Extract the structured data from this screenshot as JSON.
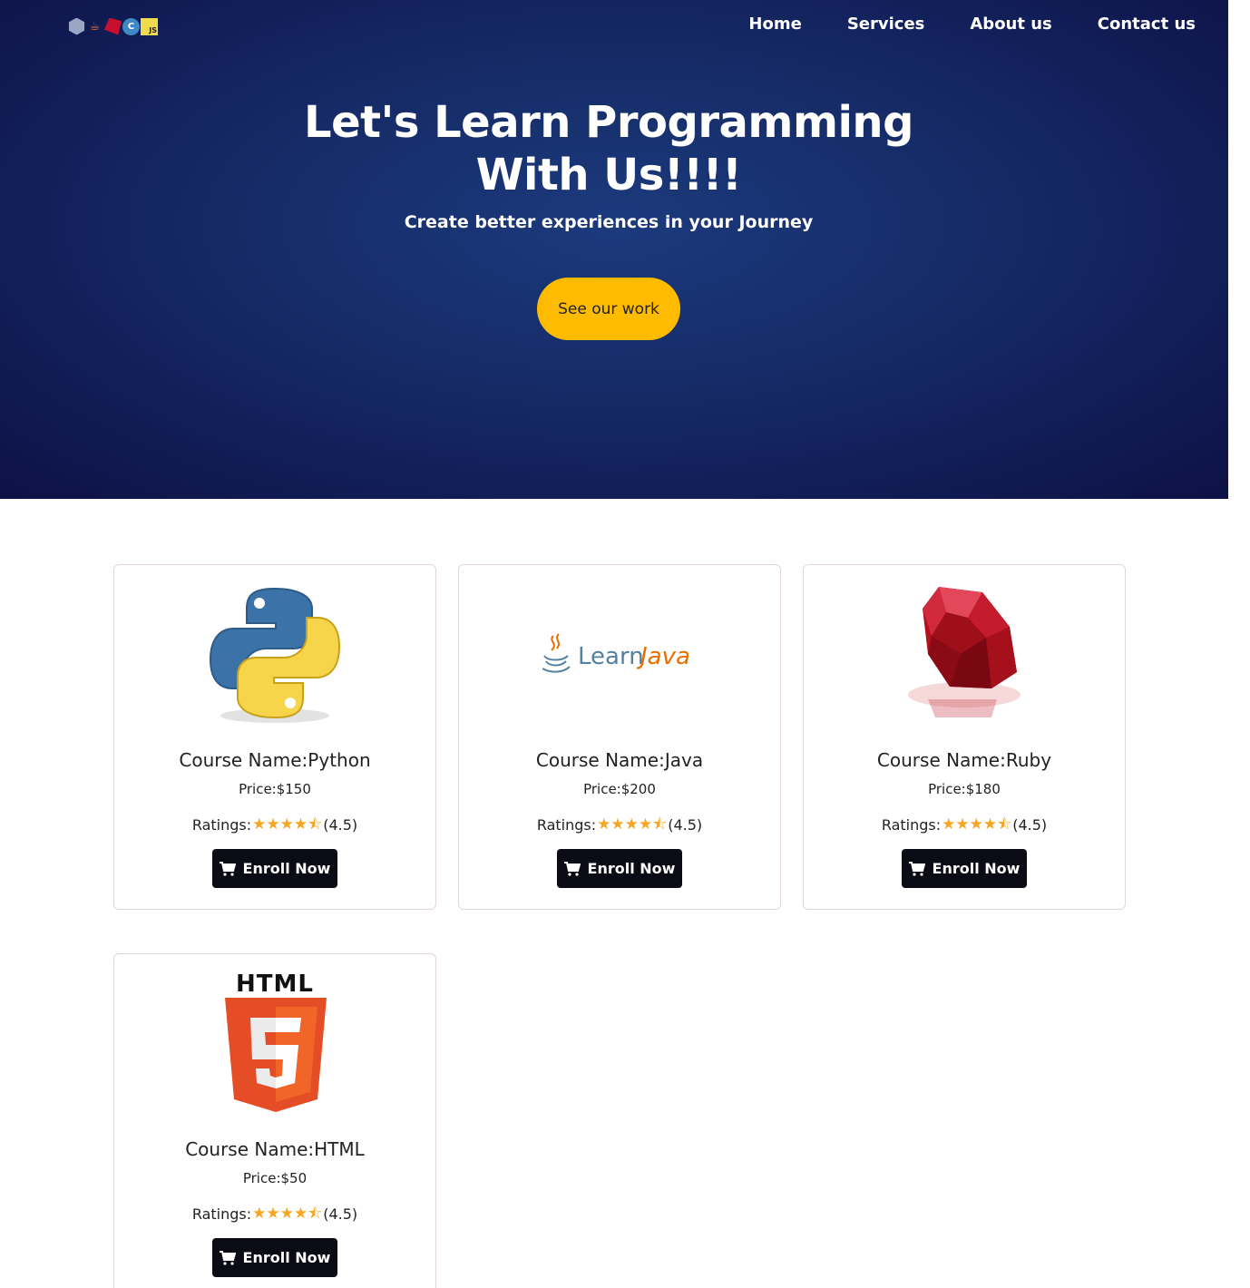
{
  "header": {
    "logo_icons": [
      "c-plus-plus-icon",
      "java-icon",
      "ruby-icon",
      "c-icon",
      "javascript-icon"
    ],
    "logo_js_text": "JS",
    "logo_c_text": "C",
    "nav": [
      {
        "label": "Home"
      },
      {
        "label": "Services"
      },
      {
        "label": "About us"
      },
      {
        "label": "Contact us"
      }
    ]
  },
  "hero": {
    "title_line1": "Let's Learn Programming",
    "title_line2": "With Us!!!!",
    "subtitle": "Create better experiences in your Journey",
    "cta_label": "See our work"
  },
  "courses": [
    {
      "name": "Course Name:Python",
      "price": "Price:$150",
      "ratings_label": "Ratings:",
      "rating_value": 4.5,
      "rating_text": "(4.5)",
      "button": "Enroll Now",
      "image": "python-logo"
    },
    {
      "name": "Course Name:Java",
      "price": "Price:$200",
      "ratings_label": "Ratings:",
      "rating_value": 4.5,
      "rating_text": "(4.5)",
      "button": "Enroll Now",
      "image": "learn-java-logo",
      "image_text_a": "Learn",
      "image_text_b": "Java"
    },
    {
      "name": "Course Name:Ruby",
      "price": "Price:$180",
      "ratings_label": "Ratings:",
      "rating_value": 4.5,
      "rating_text": "(4.5)",
      "button": "Enroll Now",
      "image": "ruby-gem-logo"
    },
    {
      "name": "Course Name:HTML",
      "price": "Price:$50",
      "ratings_label": "Ratings:",
      "rating_value": 4.5,
      "rating_text": "(4.5)",
      "button": "Enroll Now",
      "image": "html5-logo",
      "image_text": "HTML"
    }
  ],
  "colors": {
    "hero_bg": "#162c68",
    "accent": "#ffbb00",
    "star": "#f5a623",
    "button_bg": "#0b0b15"
  }
}
